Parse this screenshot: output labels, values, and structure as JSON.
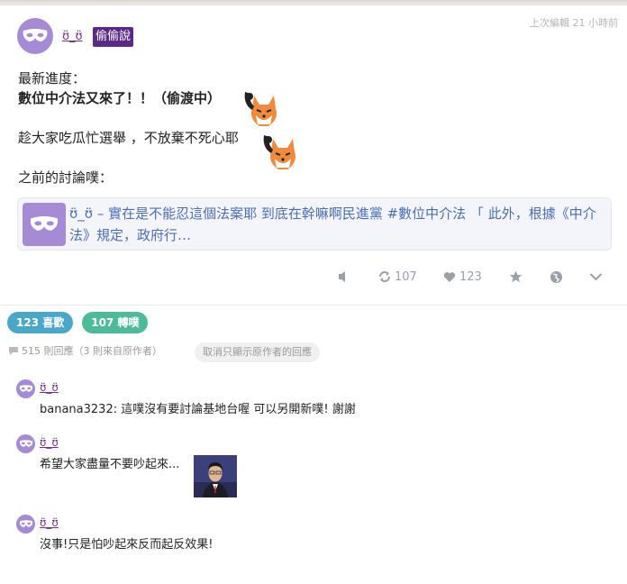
{
  "post": {
    "author": "ʊ̈_ʊ̈",
    "qualifier": "偷偷說",
    "time": "上次編輯 21 小時前",
    "lines": [
      "最新進度：",
      "數位中介法又來了！！（偷渡中）",
      "趁大家吃瓜忙選舉 ，不放棄不死心耶",
      "之前的討論噗："
    ],
    "link_card": {
      "author": "ʊ̈_ʊ̈",
      "text": "– 實在是不能忍這個法案耶 到底在幹嘛啊民進黨 #數位中介法 「 此外，根據《中介法》規定，政府行…"
    },
    "actions": {
      "replurk_count": "107",
      "like_count": "123"
    }
  },
  "summary": {
    "likes": "123 喜歡",
    "replurks": "107 轉噗",
    "response_stats": "515 則回應（3 則來自原作者）",
    "filter_button": "取消只顯示原作者的回應"
  },
  "responses": [
    {
      "author": "ʊ̈_ʊ̈",
      "text": "banana3232: 這噗沒有要討論基地台喔 可以另開新噗! 謝謝"
    },
    {
      "author": "ʊ̈_ʊ̈",
      "text": "希望大家盡量不要吵起來..."
    },
    {
      "author": "ʊ̈_ʊ̈",
      "text": "沒事!只是怕吵起來反而起反效果!"
    }
  ],
  "colors": {
    "avatar": "#a58bd6",
    "qualifier_bg": "#5b2a86",
    "link": "#4a6db5",
    "likes_pill": "#4aa7c8",
    "replurks_pill": "#4dbb97"
  },
  "icons": [
    "mask-icon",
    "fox-sticker-icon",
    "mute-icon",
    "replurk-icon",
    "heart-icon",
    "star-icon",
    "globe-icon",
    "chevron-down-icon",
    "comment-icon"
  ]
}
